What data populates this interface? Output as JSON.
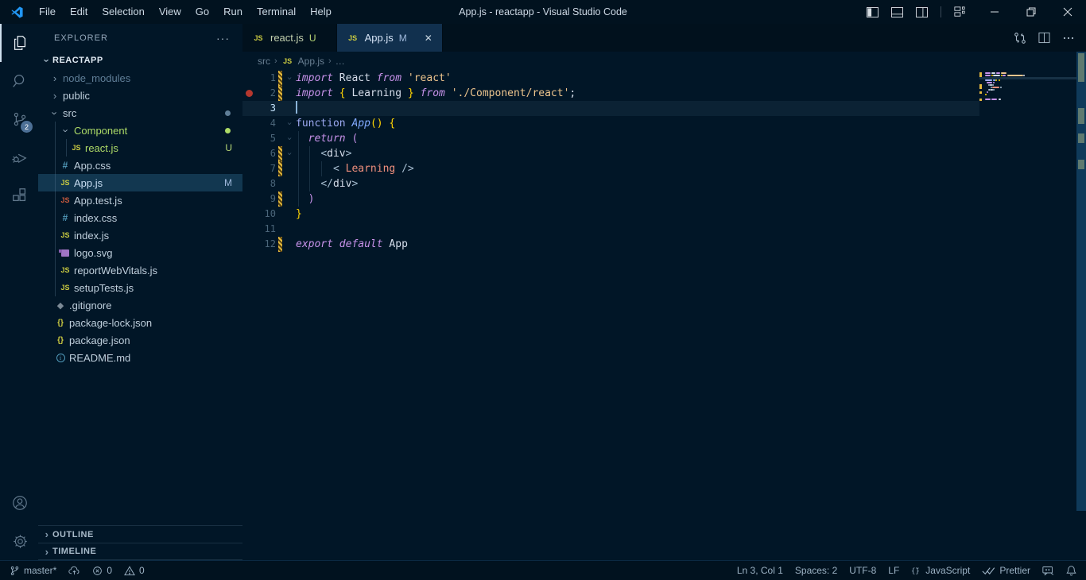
{
  "colors": {
    "accent_blue": "#2196f3",
    "badge_bg": "#4d7096",
    "untracked_green": "#addb67",
    "modified_blue": "#a0b9dc",
    "error_red": "#b5372e",
    "gutter_modified_gold": "#e2b93d",
    "string_orange": "#ecc48d",
    "keyword_purple": "#c792ea"
  },
  "title_bar": {
    "title": "App.js - reactapp - Visual Studio Code",
    "menus": [
      "File",
      "Edit",
      "Selection",
      "View",
      "Go",
      "Run",
      "Terminal",
      "Help"
    ]
  },
  "activity_bar": {
    "scm_badge": "2",
    "items": [
      "explorer",
      "search",
      "source-control",
      "run-and-debug",
      "extensions"
    ],
    "bottom_items": [
      "accounts",
      "manage"
    ]
  },
  "explorer": {
    "header": "EXPLORER",
    "more_actions": "···",
    "project": {
      "label": "REACTAPP",
      "expanded": true
    },
    "tree": [
      {
        "label": "node_modules",
        "kind": "folder",
        "expanded": false,
        "indent": 14,
        "color": "dim"
      },
      {
        "label": "public",
        "kind": "folder",
        "expanded": false,
        "indent": 14
      },
      {
        "label": "src",
        "kind": "folder",
        "expanded": true,
        "indent": 14,
        "dot": "#5f7e97"
      },
      {
        "label": "Component",
        "kind": "folder",
        "expanded": true,
        "indent": 28,
        "color": "green",
        "dot": "#addb67"
      },
      {
        "label": "react.js",
        "kind": "file",
        "icon": "js",
        "indent": 40,
        "color": "green",
        "badge": "U"
      },
      {
        "label": "App.css",
        "kind": "file",
        "icon": "css",
        "indent": 26
      },
      {
        "label": "App.js",
        "kind": "file",
        "icon": "js",
        "indent": 26,
        "color": "mod",
        "badge": "M",
        "selected": true
      },
      {
        "label": "App.test.js",
        "kind": "file",
        "icon": "jstest",
        "indent": 26
      },
      {
        "label": "index.css",
        "kind": "file",
        "icon": "css",
        "indent": 26
      },
      {
        "label": "index.js",
        "kind": "file",
        "icon": "js",
        "indent": 26
      },
      {
        "label": "logo.svg",
        "kind": "file",
        "icon": "svg",
        "indent": 26
      },
      {
        "label": "reportWebVitals.js",
        "kind": "file",
        "icon": "js",
        "indent": 26
      },
      {
        "label": "setupTests.js",
        "kind": "file",
        "icon": "js",
        "indent": 26
      },
      {
        "label": ".gitignore",
        "kind": "file",
        "icon": "git",
        "indent": 20
      },
      {
        "label": "package-lock.json",
        "kind": "file",
        "icon": "json",
        "indent": 20
      },
      {
        "label": "package.json",
        "kind": "file",
        "icon": "json",
        "indent": 20
      },
      {
        "label": "README.md",
        "kind": "file",
        "icon": "info",
        "indent": 20
      }
    ],
    "sections": [
      {
        "label": "OUTLINE"
      },
      {
        "label": "TIMELINE"
      }
    ]
  },
  "editor": {
    "tabs": [
      {
        "label": "react.js",
        "icon": "js",
        "badge": "U",
        "badge_class": "u",
        "active": false,
        "closable": false
      },
      {
        "label": "App.js",
        "icon": "js",
        "badge": "M",
        "badge_class": "m",
        "active": true,
        "closable": true
      }
    ],
    "close_glyph": "✕",
    "breadcrumb": {
      "items": [
        "src",
        "App.js",
        "…"
      ],
      "icon_before_index": 1
    },
    "code": {
      "lines": [
        {
          "n": 1,
          "mod": true,
          "fold": true,
          "tokens": [
            [
              "kw",
              "import"
            ],
            [
              "fg",
              " React "
            ],
            [
              "kw",
              "from"
            ],
            [
              "fg",
              " "
            ],
            [
              "str",
              "'react'"
            ]
          ]
        },
        {
          "n": 2,
          "mod": true,
          "bp": true,
          "tokens": [
            [
              "kw",
              "import"
            ],
            [
              "fg",
              " "
            ],
            [
              "gold",
              "{"
            ],
            [
              "fg",
              " Learning "
            ],
            [
              "gold",
              "}"
            ],
            [
              "fg",
              " "
            ],
            [
              "kw",
              "from"
            ],
            [
              "fg",
              " "
            ],
            [
              "str",
              "'./Component/react'"
            ],
            [
              "fg",
              ";"
            ]
          ]
        },
        {
          "n": 3,
          "current": true,
          "cursor": true,
          "tokens": []
        },
        {
          "n": 4,
          "fold": true,
          "tokens": [
            [
              "st",
              "function"
            ],
            [
              "fg",
              " "
            ],
            [
              "fn",
              "App"
            ],
            [
              "gold",
              "()"
            ],
            [
              "fg",
              " "
            ],
            [
              "gold",
              "{"
            ]
          ]
        },
        {
          "n": 5,
          "fold": true,
          "tokens": [
            [
              "fg",
              "  "
            ],
            [
              "kw",
              "return"
            ],
            [
              "fg",
              " "
            ],
            [
              "pink",
              "("
            ]
          ]
        },
        {
          "n": 6,
          "mod": true,
          "fold": true,
          "tokens": [
            [
              "fg",
              "    "
            ],
            [
              "tb",
              "<"
            ],
            [
              "tag",
              "div"
            ],
            [
              "tb",
              ">"
            ]
          ]
        },
        {
          "n": 7,
          "mod": true,
          "tokens": [
            [
              "fg",
              "      "
            ],
            [
              "tb",
              "< "
            ],
            [
              "comp",
              "Learning"
            ],
            [
              "tb",
              " />"
            ]
          ]
        },
        {
          "n": 8,
          "tokens": [
            [
              "fg",
              "    "
            ],
            [
              "tb",
              "</"
            ],
            [
              "tag",
              "div"
            ],
            [
              "tb",
              ">"
            ]
          ]
        },
        {
          "n": 9,
          "mod": true,
          "tokens": [
            [
              "fg",
              "  "
            ],
            [
              "pink",
              ")"
            ]
          ]
        },
        {
          "n": 10,
          "tokens": [
            [
              "gold",
              "}"
            ]
          ]
        },
        {
          "n": 11,
          "tokens": []
        },
        {
          "n": 12,
          "mod": true,
          "tokens": [
            [
              "kw",
              "export"
            ],
            [
              "fg",
              " "
            ],
            [
              "kw",
              "default"
            ],
            [
              "fg",
              " "
            ],
            [
              "fg",
              "App"
            ]
          ]
        }
      ]
    }
  },
  "status_bar": {
    "left": [
      {
        "icon": "branch",
        "label": "master*",
        "name": "git-branch-status"
      },
      {
        "icon": "cloud-upload",
        "label": "",
        "name": "publish-changes"
      },
      {
        "icon": "error",
        "label": "0",
        "name": "error-count"
      },
      {
        "icon": "warning",
        "label": "0",
        "name": "warning-count"
      }
    ],
    "right": [
      {
        "icon": "",
        "label": "Ln 3, Col 1",
        "name": "cursor-position"
      },
      {
        "icon": "",
        "label": "Spaces: 2",
        "name": "indentation"
      },
      {
        "icon": "",
        "label": "UTF-8",
        "name": "encoding"
      },
      {
        "icon": "",
        "label": "LF",
        "name": "eol-sequence"
      },
      {
        "icon": "braces",
        "label": "JavaScript",
        "name": "language-mode"
      },
      {
        "icon": "double-check",
        "label": "Prettier",
        "name": "formatter-prettier"
      },
      {
        "icon": "feedback",
        "label": "",
        "name": "feedback"
      },
      {
        "icon": "bell",
        "label": "",
        "name": "notifications"
      }
    ]
  }
}
